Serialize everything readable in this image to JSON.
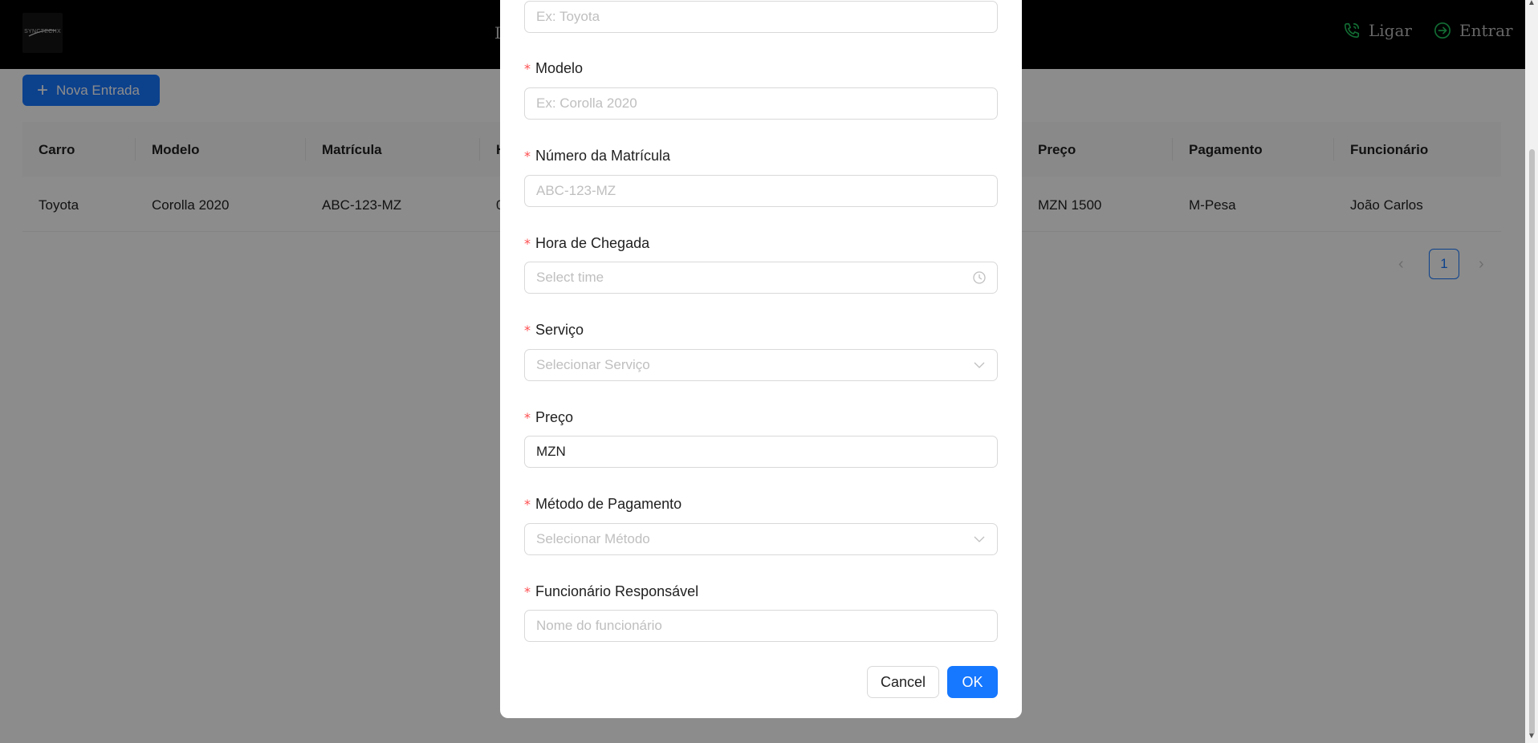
{
  "header": {
    "logo_text": "SYNCTECHX",
    "nav_peek": "I",
    "ligar_label": "Ligar",
    "entrar_label": "Entrar",
    "accent": "#22c55e"
  },
  "page": {
    "new_entry_label": "Nova Entrada",
    "table": {
      "columns": [
        "Carro",
        "Modelo",
        "Matrícula",
        "H",
        "Preço",
        "Pagamento",
        "Funcionário"
      ],
      "rows": [
        [
          "Toyota",
          "Corolla 2020",
          "ABC-123-MZ",
          "0",
          "MZN 1500",
          "M-Pesa",
          "João Carlos"
        ]
      ]
    },
    "pagination": {
      "prev": "‹",
      "current": "1",
      "next": "›"
    }
  },
  "modal": {
    "fields": {
      "carro": {
        "placeholder": "Ex: Toyota"
      },
      "modelo": {
        "label": "Modelo",
        "placeholder": "Ex: Corolla 2020"
      },
      "matricula": {
        "label": "Número da Matrícula",
        "placeholder": "ABC-123-MZ"
      },
      "hora": {
        "label": "Hora de Chegada",
        "placeholder": "Select time"
      },
      "servico": {
        "label": "Serviço",
        "placeholder": "Selecionar Serviço"
      },
      "preco": {
        "label": "Preço",
        "value": "MZN"
      },
      "pagamento": {
        "label": "Método de Pagamento",
        "placeholder": "Selecionar Método"
      },
      "funcionario": {
        "label": "Funcionário Responsável",
        "placeholder": "Nome do funcionário"
      }
    },
    "required_mark": "*",
    "cancel_label": "Cancel",
    "ok_label": "OK",
    "primary_color": "#1677ff",
    "required_color": "#ff4d4f"
  },
  "icons": {
    "plus": "plus-icon",
    "phone": "phone-icon",
    "login": "login-icon",
    "clock": "clock-icon",
    "chevron": "chevron-down-icon"
  }
}
